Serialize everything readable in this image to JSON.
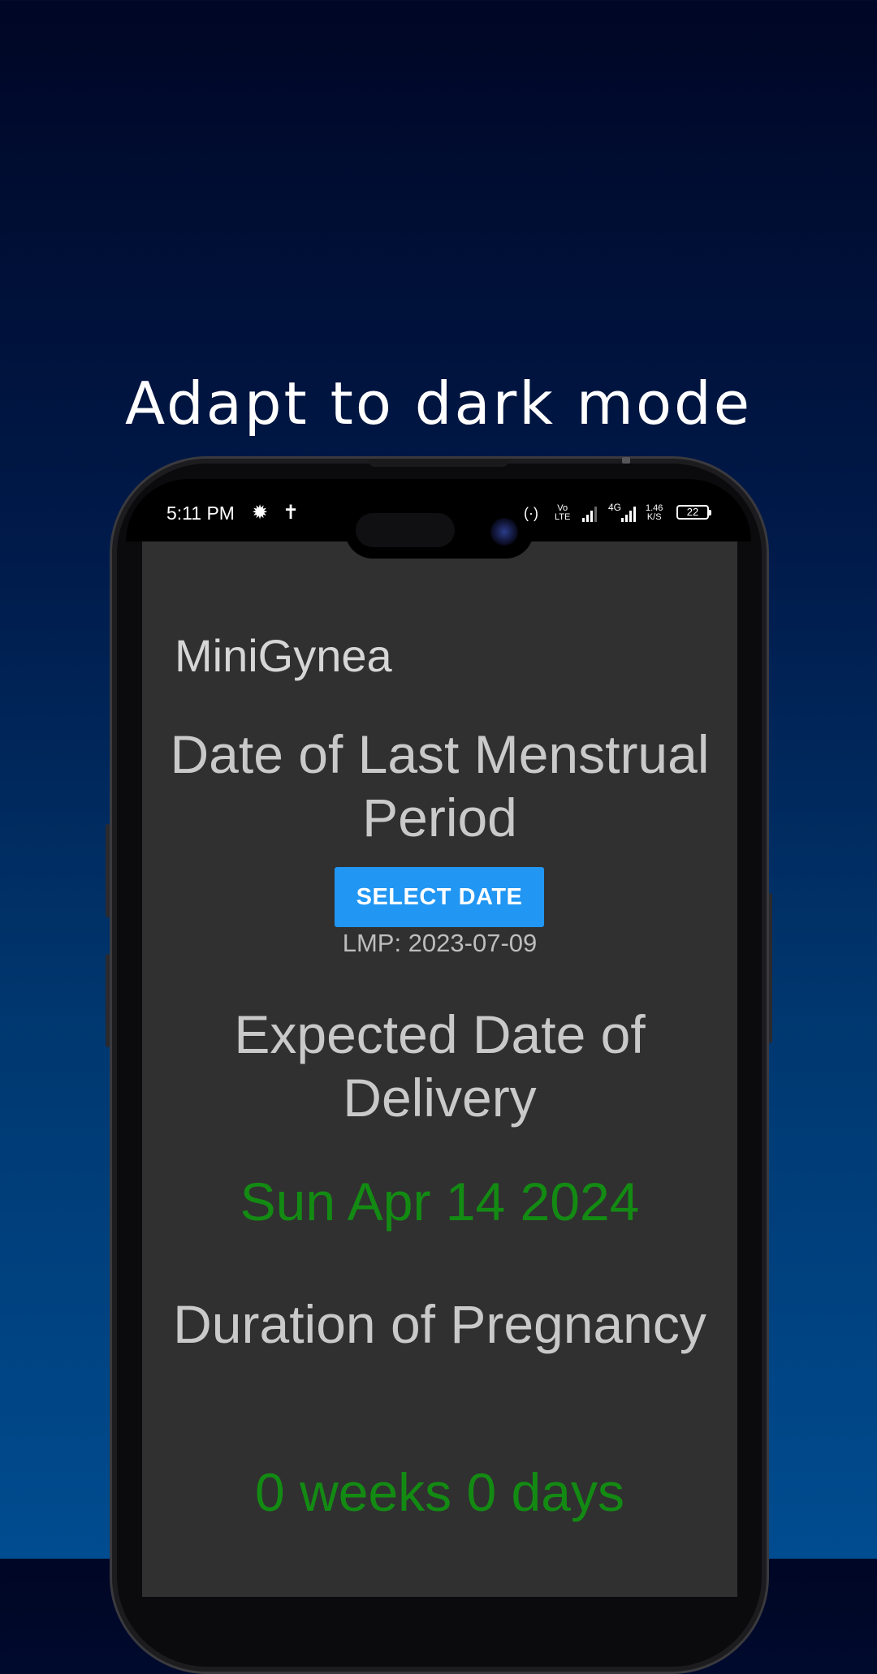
{
  "promo": {
    "headline": "Adapt to dark mode"
  },
  "status_bar": {
    "time": "5:11 PM",
    "left_icons": [
      "settings-icon",
      "accessibility-icon"
    ],
    "network_1": "VoLTE",
    "network_2": "4G",
    "speed": "1.46 K/S",
    "battery": "22"
  },
  "app": {
    "title": "MiniGynea",
    "lmp_heading": "Date of Last Menstrual Period",
    "select_date_label": "SELECT DATE",
    "lmp_value": "LMP: 2023-07-09",
    "edd_heading": "Expected Date of Delivery",
    "edd_value": "Sun Apr 14 2024",
    "duration_heading": "Duration of Pregnancy",
    "duration_value": "0 weeks 0 days"
  },
  "colors": {
    "background_top": "#000625",
    "background_bottom": "#004c90",
    "screen": "#303030",
    "button": "#2196f3",
    "result_green": "#138b13"
  }
}
